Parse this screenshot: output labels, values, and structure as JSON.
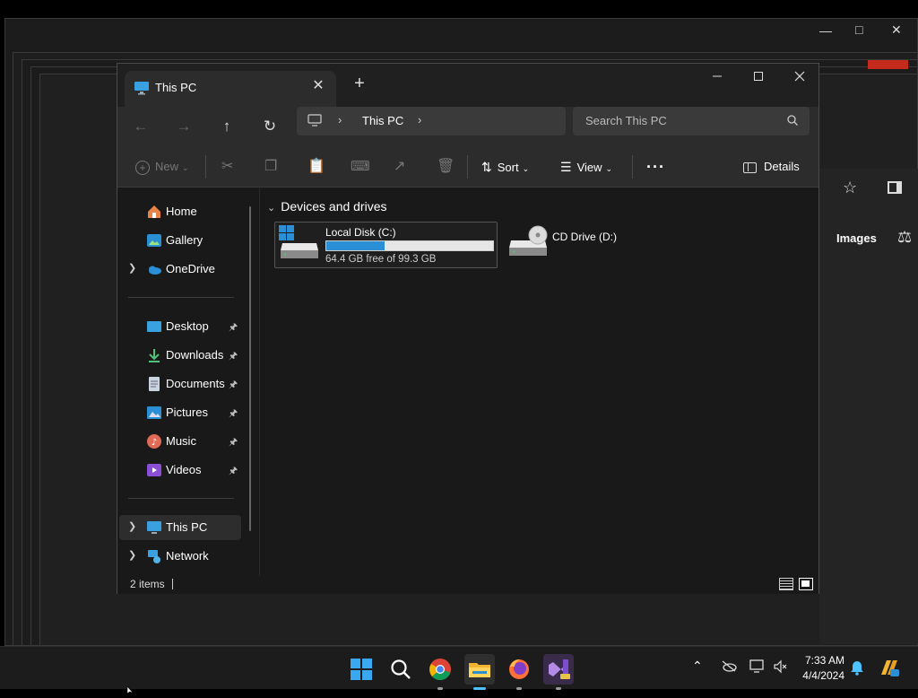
{
  "explorer": {
    "tab_title": "This PC",
    "address_location": "This PC",
    "search_placeholder": "Search This PC",
    "commands": {
      "new": "New",
      "sort": "Sort",
      "view": "View",
      "details": "Details"
    },
    "nav": {
      "home": "Home",
      "gallery": "Gallery",
      "onedrive": "OneDrive",
      "desktop": "Desktop",
      "downloads": "Downloads",
      "documents": "Documents",
      "pictures": "Pictures",
      "music": "Music",
      "videos": "Videos",
      "this_pc": "This PC",
      "network": "Network"
    },
    "section_title": "Devices and drives",
    "drives": {
      "c": {
        "name": "Local Disk (C:)",
        "free_text": "64.4 GB free of 99.3 GB",
        "used_fraction": 0.35
      },
      "d": {
        "name": "CD Drive (D:)"
      }
    },
    "status_items": "2 items"
  },
  "background": {
    "images_label": "Images"
  },
  "taskbar": {
    "time": "7:33 AM",
    "date": "4/4/2024"
  },
  "colors": {
    "accent": "#2b8fd6",
    "window_bg": "#191919",
    "bar_bg": "#2c2c2c"
  }
}
